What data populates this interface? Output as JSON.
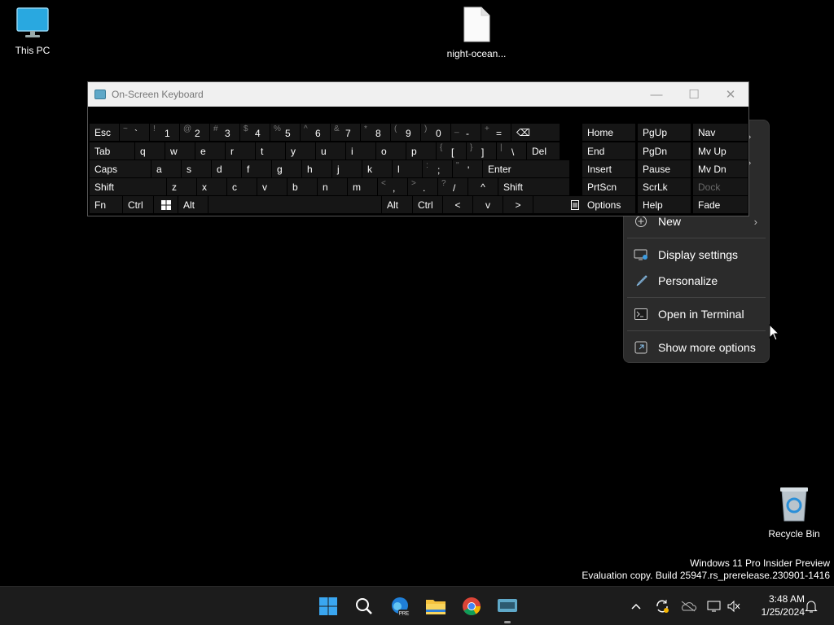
{
  "desktop": {
    "icons": [
      {
        "label": "This PC",
        "icon": "monitor-icon"
      },
      {
        "label": "night-ocean...",
        "icon": "file-icon"
      },
      {
        "label": "Recycle Bin",
        "icon": "recycle-bin-icon"
      }
    ]
  },
  "context_menu": {
    "items": [
      {
        "label": "New",
        "icon": "plus-circle-icon",
        "has_submenu": true
      },
      {
        "label": "Display settings",
        "icon": "display-settings-icon"
      },
      {
        "label": "Personalize",
        "icon": "brush-icon"
      },
      {
        "label": "Open in Terminal",
        "icon": "terminal-icon"
      },
      {
        "label": "Show more options",
        "icon": "show-more-icon"
      }
    ]
  },
  "osk": {
    "title": "On-Screen Keyboard",
    "rows": {
      "row1": [
        {
          "label": "Esc"
        },
        {
          "sec": "~",
          "pri": "`"
        },
        {
          "sec": "!",
          "pri": "1"
        },
        {
          "sec": "@",
          "pri": "2"
        },
        {
          "sec": "#",
          "pri": "3"
        },
        {
          "sec": "$",
          "pri": "4"
        },
        {
          "sec": "%",
          "pri": "5"
        },
        {
          "sec": "^",
          "pri": "6"
        },
        {
          "sec": "&",
          "pri": "7"
        },
        {
          "sec": "*",
          "pri": "8"
        },
        {
          "sec": "(",
          "pri": "9"
        },
        {
          "sec": ")",
          "pri": "0"
        },
        {
          "sec": "_",
          "pri": "-"
        },
        {
          "sec": "+",
          "pri": "="
        },
        {
          "label": "⌫"
        }
      ],
      "row2": [
        {
          "label": "Tab"
        },
        {
          "label": "q"
        },
        {
          "label": "w"
        },
        {
          "label": "e"
        },
        {
          "label": "r"
        },
        {
          "label": "t"
        },
        {
          "label": "y"
        },
        {
          "label": "u"
        },
        {
          "label": "i"
        },
        {
          "label": "o"
        },
        {
          "label": "p"
        },
        {
          "sec": "{",
          "pri": "["
        },
        {
          "sec": "}",
          "pri": "]"
        },
        {
          "sec": "|",
          "pri": "\\"
        },
        {
          "label": "Del"
        }
      ],
      "row3": [
        {
          "label": "Caps"
        },
        {
          "label": "a"
        },
        {
          "label": "s"
        },
        {
          "label": "d"
        },
        {
          "label": "f"
        },
        {
          "label": "g"
        },
        {
          "label": "h"
        },
        {
          "label": "j"
        },
        {
          "label": "k"
        },
        {
          "label": "l"
        },
        {
          "sec": ":",
          "pri": ";"
        },
        {
          "sec": "\"",
          "pri": "'"
        },
        {
          "label": "Enter"
        }
      ],
      "row4": [
        {
          "label": "Shift"
        },
        {
          "label": "z"
        },
        {
          "label": "x"
        },
        {
          "label": "c"
        },
        {
          "label": "v"
        },
        {
          "label": "b"
        },
        {
          "label": "n"
        },
        {
          "label": "m"
        },
        {
          "sec": "<",
          "pri": ","
        },
        {
          "sec": ">",
          "pri": "."
        },
        {
          "sec": "?",
          "pri": "/"
        },
        {
          "label": "^"
        },
        {
          "label": "Shift"
        }
      ],
      "row5": [
        {
          "label": "Fn"
        },
        {
          "label": "Ctrl"
        },
        {
          "label": ""
        },
        {
          "label": "Alt"
        },
        {
          "label": ""
        },
        {
          "label": "Alt"
        },
        {
          "label": "Ctrl"
        },
        {
          "label": "<"
        },
        {
          "label": "v"
        },
        {
          "label": ">"
        },
        {
          "label": ""
        }
      ],
      "nav1": [
        "Home",
        "End",
        "Insert",
        "PrtScn",
        "Options"
      ],
      "nav2": [
        "PgUp",
        "PgDn",
        "Pause",
        "ScrLk",
        "Help"
      ],
      "nav3": [
        "Nav",
        "Mv Up",
        "Mv Dn",
        "Dock",
        "Fade"
      ]
    }
  },
  "watermark": {
    "line1": "Windows 11 Pro Insider Preview",
    "line2": "Evaluation copy. Build 25947.rs_prerelease.230901-1416"
  },
  "taskbar": {
    "apps": [
      "start-icon",
      "search-icon",
      "edge-preview-icon",
      "file-explorer-icon",
      "chrome-icon",
      "on-screen-keyboard-icon"
    ],
    "tray": [
      "chevron-up-icon",
      "sync-icon",
      "onedrive-icon",
      "display-icon",
      "volume-muted-icon"
    ],
    "time": "3:48 AM",
    "date": "1/25/2024"
  },
  "colors": {
    "desktop_bg": "#000000",
    "menu_bg": "#2b2b2b",
    "key_bg": "#161616",
    "taskbar_bg": "#1c1c1c"
  }
}
